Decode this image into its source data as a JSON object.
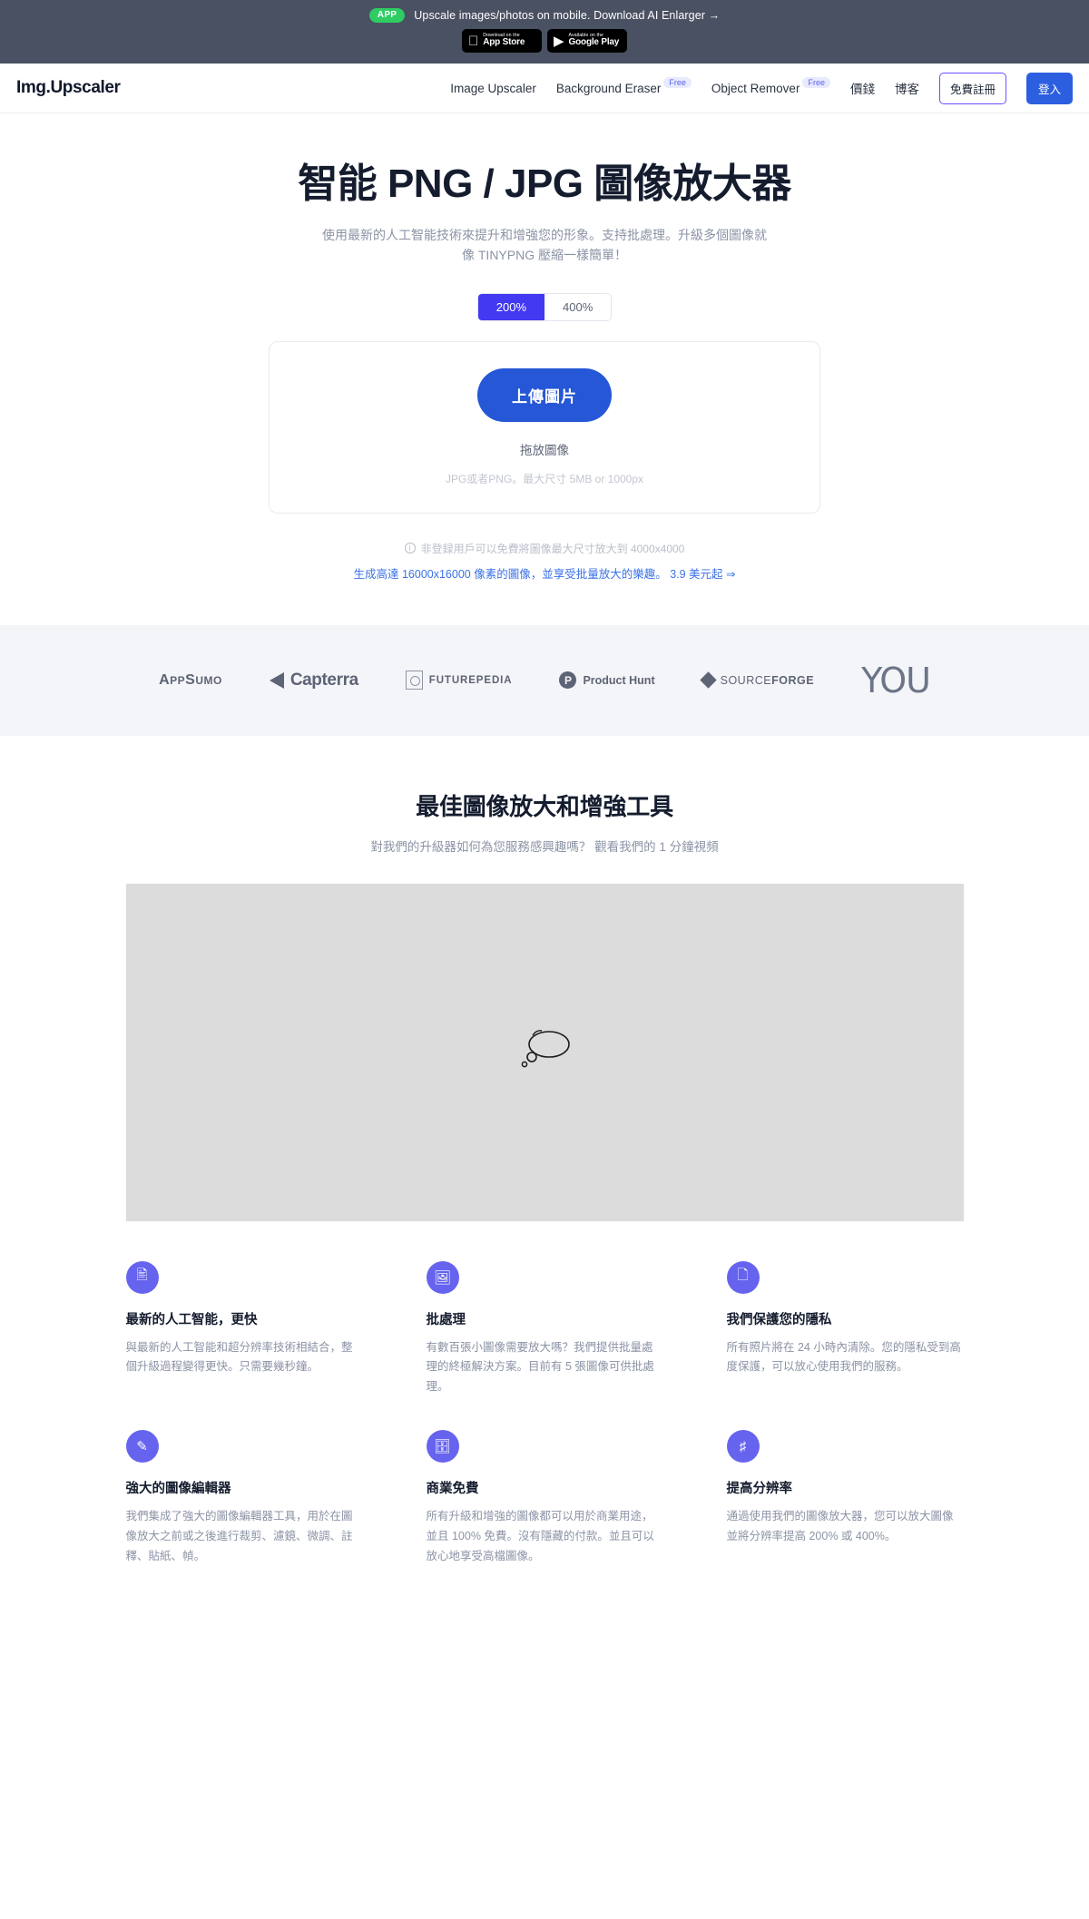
{
  "banner": {
    "pill": "APP",
    "text": "Upscale images/photos on mobile. Download AI Enlarger →",
    "appstore": {
      "small": "Download on the",
      "big": "App Store",
      "icon": "apple-icon"
    },
    "googleplay": {
      "small": "Available on the",
      "big": "Google Play",
      "icon": "google-play-icon"
    }
  },
  "nav": {
    "brand": "Img.Upscaler",
    "links": [
      {
        "label": "Image Upscaler",
        "tag": ""
      },
      {
        "label": "Background Eraser",
        "tag": "Free"
      },
      {
        "label": "Object Remover",
        "tag": "Free"
      },
      {
        "label": "價錢",
        "tag": ""
      },
      {
        "label": "博客",
        "tag": ""
      }
    ],
    "signup": "免費註冊",
    "login": "登入"
  },
  "hero": {
    "title": "智能 PNG / JPG 圖像放大器",
    "subtitle": "使用最新的人工智能技術來提升和增強您的形象。支持批處理。升級多個圖像就像 TINYPNG 壓縮一樣簡單！",
    "toggle": {
      "options": [
        "200%",
        "400%"
      ],
      "selected": "200%"
    },
    "upload_button": "上傳圖片",
    "drop_text": "拖放圖像",
    "hint_text": "JPG或者PNG。最大尺寸 5MB or 1000px",
    "notice": "非登録用戶可以免費將圖像最大尺寸放大到 4000x4000",
    "notice_icon": "info-icon",
    "notice_link": "生成高達 16000x16000 像素的圖像，並享受批量放大的樂趣。 3.9 美元起 ⇒"
  },
  "logos": [
    {
      "name": "appsumo",
      "text1": "A",
      "text2": "PP",
      "text3": "S",
      "text4": "UMO"
    },
    {
      "name": "capterra",
      "text": "Capterra"
    },
    {
      "name": "futurepedia",
      "text": "FUTUREPEDIA"
    },
    {
      "name": "product-hunt",
      "mark": "P",
      "text": "Product Hunt"
    },
    {
      "name": "sourceforge",
      "text1": "SOURCE",
      "text2": "FORGE"
    },
    {
      "name": "you",
      "text": "YOU"
    }
  ],
  "section2": {
    "title": "最佳圖像放大和增強工具",
    "subtitle": "對我們的升級器如何為您服務感興趣嗎？ 觀看我們的 1 分鐘視頻",
    "video_placeholder_icon": "thought-bubble-icon"
  },
  "features": [
    {
      "icon": "document-scan-icon",
      "title": "最新的人工智能，更快",
      "desc": "與最新的人工智能和超分辨率技術相結合，整個升級過程變得更快。只需要幾秒鐘。"
    },
    {
      "icon": "batch-image-icon",
      "title": "批處理",
      "desc": "有數百張小圖像需要放大嗎？我們提供批量處理的終極解決方案。目前有 5 張圖像可供批處理。"
    },
    {
      "icon": "shield-file-icon",
      "title": "我們保護您的隱私",
      "desc": "所有照片將在 24 小時內清除。您的隱私受到高度保護，可以放心使用我們的服務。"
    },
    {
      "icon": "edit-tools-icon",
      "title": "強大的圖像編輯器",
      "desc": "我們集成了強大的圖像編輯器工具，用於在圖像放大之前或之後進行裁剪、濾鏡、微調、註釋、貼紙、幀。"
    },
    {
      "icon": "commercial-icon",
      "title": "商業免費",
      "desc": "所有升級和增強的圖像都可以用於商業用途，並且 100% 免費。沒有隱藏的付款。並且可以放心地享受高檔圖像。"
    },
    {
      "icon": "resolution-icon",
      "title": "提高分辨率",
      "desc": "通過使用我們的圖像放大器，您可以放大圖像並將分辨率提高 200% 或 400%。"
    }
  ],
  "colors": {
    "banner_bg": "#4a5162",
    "accent_blue": "#2557d6",
    "toggle_active": "#4339f2",
    "feature_icon": "#6663ee",
    "link_blue": "#3b72e8"
  }
}
